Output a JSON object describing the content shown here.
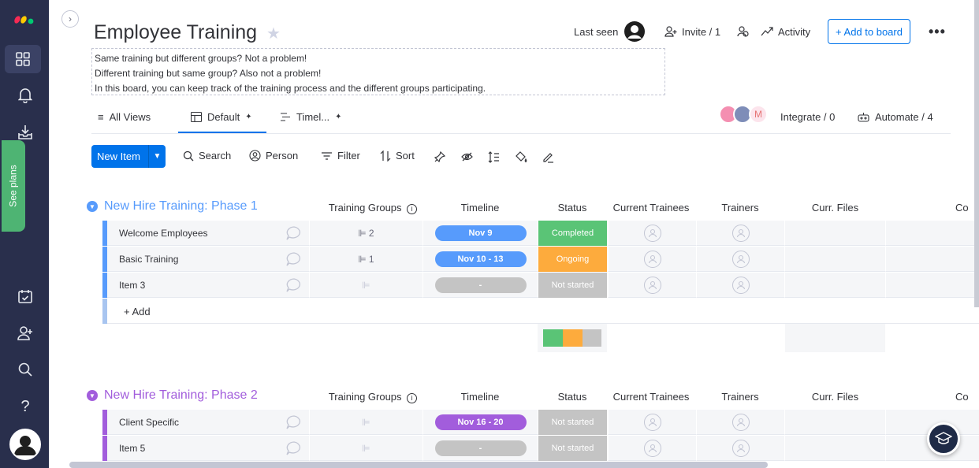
{
  "sidebar": {
    "see_plans": "See plans",
    "help_glyph": "?"
  },
  "header": {
    "title": "Employee Training",
    "description": [
      "Same training but different groups? Not a problem!",
      "Different training but same group? Also not a problem!",
      "In this board, you can keep track of the training process and the different groups participating."
    ],
    "last_seen": "Last seen",
    "invite": "Invite / 1",
    "activity": "Activity",
    "add_to_board": "+ Add to board"
  },
  "views": {
    "all_views": "All Views",
    "default": "Default",
    "timeline": "Timel...",
    "integrate": "Integrate / 0",
    "automate": "Automate / 4"
  },
  "toolbar": {
    "new_item": "New Item",
    "search": "Search",
    "person": "Person",
    "filter": "Filter",
    "sort": "Sort"
  },
  "columns": [
    "Training Groups",
    "Timeline",
    "Status",
    "Current Trainees",
    "Trainers",
    "Curr. Files",
    "Co"
  ],
  "colors": {
    "phase1": "#579bfc",
    "phase2": "#a25ddc",
    "completed": "#5ac476",
    "ongoing": "#fdab3d",
    "not_started": "#c4c4c4",
    "timeline_blue": "#579bfc",
    "timeline_purple": "#a25ddc",
    "timeline_empty": "#c4c4c4"
  },
  "groups": [
    {
      "title": "New Hire Training: Phase 1",
      "rows": [
        {
          "name": "Welcome Employees",
          "groups_count": "2",
          "timeline": "Nov 9",
          "status": "Completed"
        },
        {
          "name": "Basic Training",
          "groups_count": "1",
          "timeline": "Nov 10 - 13",
          "status": "Ongoing"
        },
        {
          "name": "Item 3",
          "groups_count": "",
          "timeline": "-",
          "status": "Not started"
        }
      ],
      "add_label": "+ Add"
    },
    {
      "title": "New Hire Training: Phase 2",
      "rows": [
        {
          "name": "Client Specific",
          "groups_count": "",
          "timeline": "Nov 16 - 20",
          "status": "Not started"
        },
        {
          "name": "Item 5",
          "groups_count": "",
          "timeline": "-",
          "status": "Not started"
        }
      ]
    }
  ]
}
